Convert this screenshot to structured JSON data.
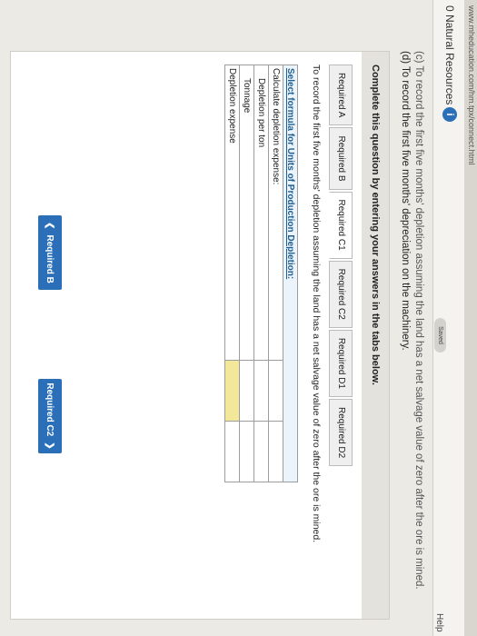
{
  "browser": {
    "url_fragment": "www.mheducation.com/hm.tpx/connect.html"
  },
  "header": {
    "title": "0 Natural Resources",
    "info_icon": "i",
    "saved_label": "Saved",
    "help_label": "Help"
  },
  "question": {
    "line_c": "(c) To record the first five months' depletion assuming the land has a net salvage value of zero after the ore is mined.",
    "line_d": "(d) To record the first five months' depreciation on the machinery."
  },
  "panel": {
    "instruction": "Complete this question by entering your answers in the tabs below.",
    "tabs": [
      "Required A",
      "Required B",
      "Required C1",
      "Required C2",
      "Required D1",
      "Required D2"
    ],
    "active_tab": "Required C1",
    "body": "To record the first five months' depletion assuming the land has a net salvage value of zero after the ore is mined."
  },
  "table": {
    "header": "Select formula for Units of Production Depletion:",
    "rows": [
      {
        "label": "Calculate depletion expense:",
        "indent": false
      },
      {
        "label": "Depletion per ton",
        "indent": true
      },
      {
        "label": "Tonnage",
        "indent": true
      },
      {
        "label": "Depletion expense",
        "indent": false
      }
    ]
  },
  "nav": {
    "prev_label": "Required B",
    "next_label": "Required C2"
  },
  "colors": {
    "accent": "#2a6fb8",
    "highlight": "#f3e79a"
  }
}
